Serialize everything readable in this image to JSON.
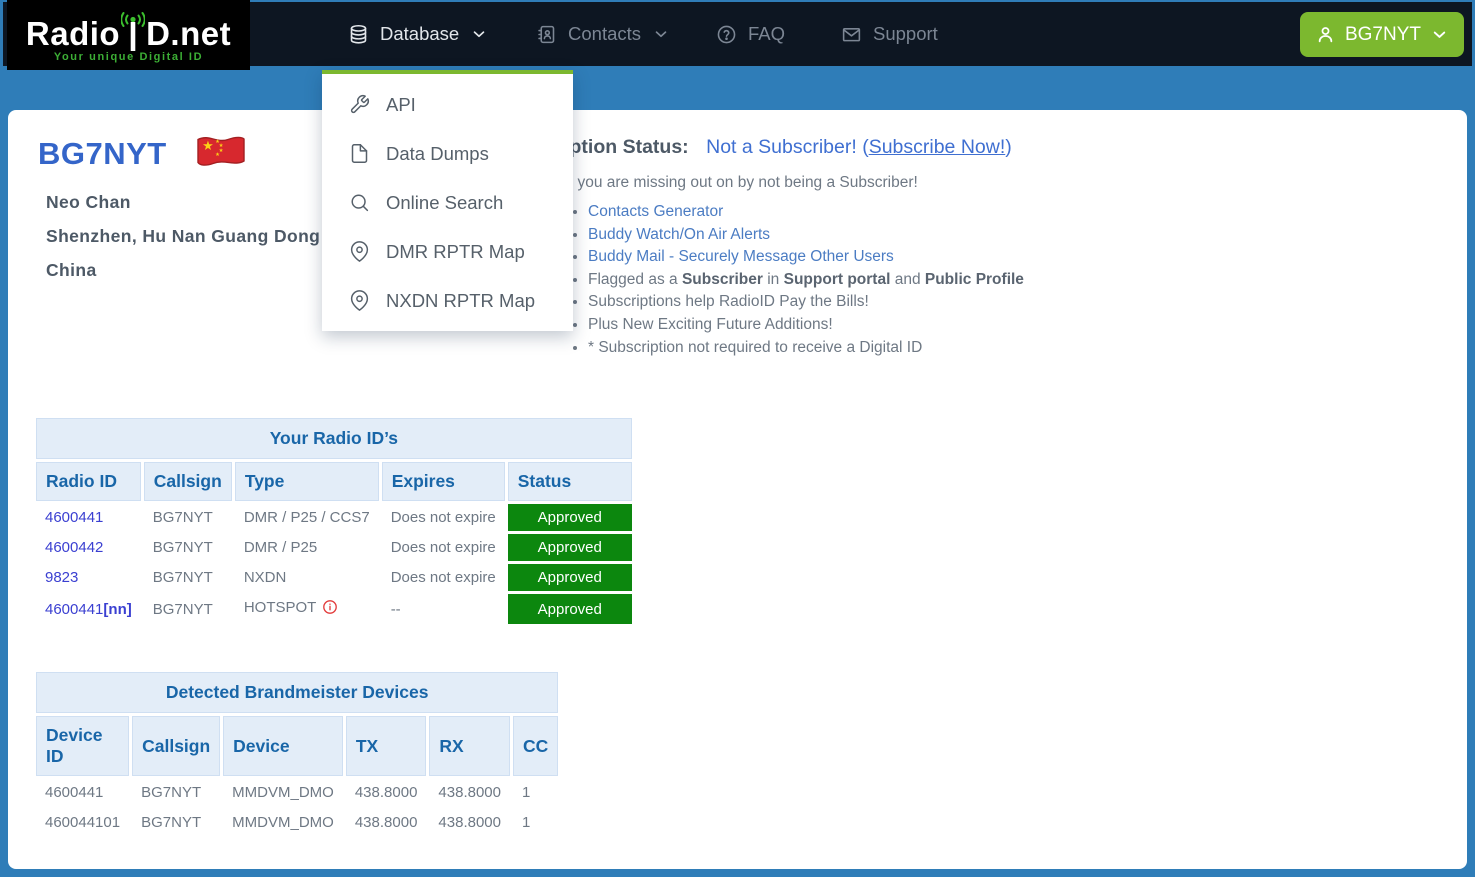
{
  "nav": {
    "logo": {
      "part1": "Radio",
      "part2": "D.net",
      "tagline": "Your unique Digital ID"
    },
    "items": {
      "database": "Database",
      "contacts": "Contacts",
      "faq": "FAQ",
      "support": "Support"
    },
    "user_button": "BG7NYT"
  },
  "dropdown": {
    "items": {
      "api": "API",
      "data_dumps": "Data Dumps",
      "online_search": "Online Search",
      "dmr_map": "DMR RPTR Map",
      "nxdn_map": "NXDN RPTR Map"
    }
  },
  "profile": {
    "callsign": "BG7NYT",
    "name": "Neo Chan",
    "address": "Shenzhen, Hu Nan Guang Dong",
    "country": "China"
  },
  "subscription": {
    "heading": "Subscription Status:",
    "status": "Not a Subscriber!",
    "subscribe_prefix": "(",
    "subscribe_link": "Subscribe Now!",
    "subscribe_suffix": ")",
    "intro": "Features you are missing out on by not being a Subscriber!",
    "benefits": {
      "link1": "Contacts Generator",
      "link2": "Buddy Watch/On Air Alerts",
      "link3": "Buddy Mail - Securely Message Other Users",
      "flagged_t1": "Flagged as a ",
      "flagged_b1": "Subscriber",
      "flagged_t2": " in ",
      "flagged_b2": "Support portal",
      "flagged_t3": " and ",
      "flagged_b3": "Public Profile",
      "item5": "Subscriptions help RadioID Pay the Bills!",
      "item6": "Plus New Exciting Future Additions!",
      "item7": "* Subscription not required to receive a Digital ID"
    }
  },
  "radio_table": {
    "title": "Your Radio ID’s",
    "columns": [
      "Radio ID",
      "Callsign",
      "Type",
      "Expires",
      "Status"
    ],
    "rows": [
      {
        "id": "4600441",
        "callsign": "BG7NYT",
        "type": "DMR / P25 / CCS7",
        "expires": "Does not expire",
        "status": "Approved"
      },
      {
        "id": "4600442",
        "callsign": "BG7NYT",
        "type": "DMR / P25",
        "expires": "Does not expire",
        "status": "Approved"
      },
      {
        "id": "9823",
        "callsign": "BG7NYT",
        "type": "NXDN",
        "expires": "Does not expire",
        "status": "Approved"
      },
      {
        "id": "4600441",
        "id_suffix": "[nn]",
        "callsign": "BG7NYT",
        "type": "HOTSPOT",
        "expires": "--",
        "status": "Approved"
      }
    ]
  },
  "bm_table": {
    "title": "Detected Brandmeister Devices",
    "columns": [
      "Device ID",
      "Callsign",
      "Device",
      "TX",
      "RX",
      "CC"
    ],
    "rows": [
      {
        "device_id": "4600441",
        "callsign": "BG7NYT",
        "device": "MMDVM_DMO",
        "tx": "438.8000",
        "rx": "438.8000",
        "cc": "1"
      },
      {
        "device_id": "460044101",
        "callsign": "BG7NYT",
        "device": "MMDVM_DMO",
        "tx": "438.8000",
        "rx": "438.8000",
        "cc": "1"
      }
    ]
  },
  "icons": [
    "database-icon",
    "contacts-icon",
    "question-icon",
    "envelope-icon",
    "user-icon",
    "chevron-down-icon",
    "antenna-icon",
    "wrench-icon",
    "file-icon",
    "search-icon",
    "map-pin-icon",
    "china-flag",
    "info-icon"
  ],
  "colors": {
    "page_bg": "#2f7db8",
    "nav_bg": "#0d1622",
    "accent_green": "#7cb82f",
    "logo_green": "#3cae35",
    "status_green": "#0c870e",
    "table_header_blue": "#1966a8",
    "callsign_blue": "#3465c9",
    "link_blue": "#3f6fd1",
    "id_link_blue": "#3a3fd1",
    "danger_red": "#e23b3b"
  }
}
